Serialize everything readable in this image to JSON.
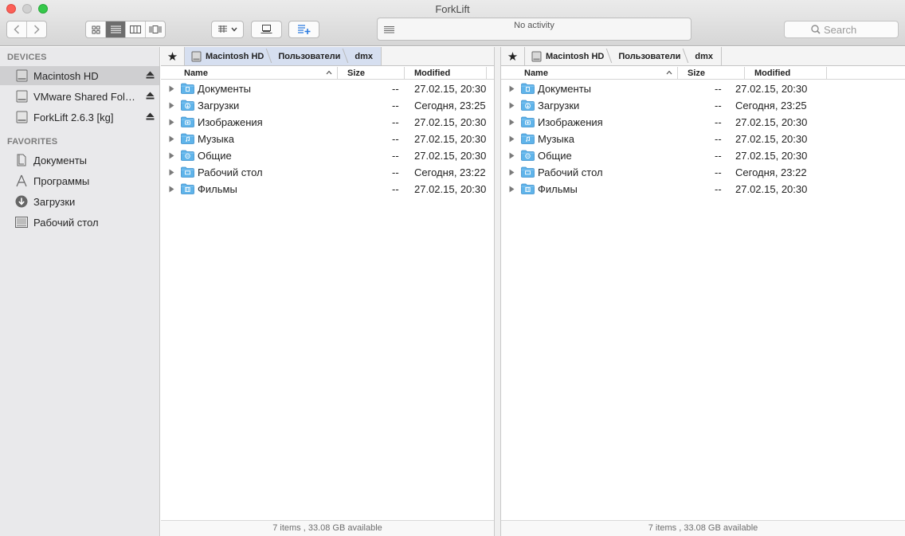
{
  "window": {
    "title": "ForkLift"
  },
  "toolbar": {
    "activity_text": "No activity",
    "search_placeholder": "Search"
  },
  "sidebar": {
    "devices_header": "DEVICES",
    "devices": [
      {
        "label": "Macintosh HD",
        "selected": true
      },
      {
        "label": "VMware Shared Fol…",
        "selected": false
      },
      {
        "label": "ForkLift 2.6.3 [kg]",
        "selected": false
      }
    ],
    "favorites_header": "FAVORITES",
    "favorites": [
      {
        "label": "Документы",
        "icon": "document-icon"
      },
      {
        "label": "Программы",
        "icon": "applications-icon"
      },
      {
        "label": "Загрузки",
        "icon": "downloads-icon"
      },
      {
        "label": "Рабочий стол",
        "icon": "desktop-icon"
      }
    ]
  },
  "left_pane": {
    "breadcrumb": [
      "Macintosh HD",
      "Пользователи",
      "dmx"
    ],
    "columns": {
      "name": "Name",
      "size": "Size",
      "modified": "Modified"
    },
    "rows": [
      {
        "name": "Документы",
        "size": "--",
        "modified": "27.02.15, 20:30"
      },
      {
        "name": "Загрузки",
        "size": "--",
        "modified": "Сегодня, 23:25"
      },
      {
        "name": "Изображения",
        "size": "--",
        "modified": "27.02.15, 20:30"
      },
      {
        "name": "Музыка",
        "size": "--",
        "modified": "27.02.15, 20:30"
      },
      {
        "name": "Общие",
        "size": "--",
        "modified": "27.02.15, 20:30"
      },
      {
        "name": "Рабочий стол",
        "size": "--",
        "modified": "Сегодня, 23:22"
      },
      {
        "name": "Фильмы",
        "size": "--",
        "modified": "27.02.15, 20:30"
      }
    ],
    "status": "7 items , 33.08 GB available"
  },
  "right_pane": {
    "breadcrumb": [
      "Macintosh HD",
      "Пользователи",
      "dmx"
    ],
    "columns": {
      "name": "Name",
      "size": "Size",
      "modified": "Modified"
    },
    "rows": [
      {
        "name": "Документы",
        "size": "--",
        "modified": "27.02.15, 20:30"
      },
      {
        "name": "Загрузки",
        "size": "--",
        "modified": "Сегодня, 23:25"
      },
      {
        "name": "Изображения",
        "size": "--",
        "modified": "27.02.15, 20:30"
      },
      {
        "name": "Музыка",
        "size": "--",
        "modified": "27.02.15, 20:30"
      },
      {
        "name": "Общие",
        "size": "--",
        "modified": "27.02.15, 20:30"
      },
      {
        "name": "Рабочий стол",
        "size": "--",
        "modified": "Сегодня, 23:22"
      },
      {
        "name": "Фильмы",
        "size": "--",
        "modified": "27.02.15, 20:30"
      }
    ],
    "status": "7 items , 33.08 GB available"
  },
  "colors": {
    "folder_blue": "#5fb4ea",
    "selection_gray": "#cfcfd1",
    "active_path": "#d6dff0"
  }
}
